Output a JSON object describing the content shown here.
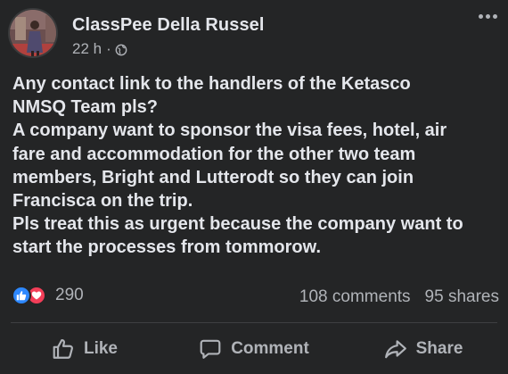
{
  "post": {
    "author": "ClassPee Della Russel",
    "time": "22 h",
    "separator": "·",
    "privacy_icon": "globe-icon",
    "lines": [
      "Any contact link to the handlers of the Ketasco",
      "NMSQ Team pls?",
      "A company want to sponsor the visa fees, hotel, air",
      "fare and accommodation for the other two team",
      "members, Bright and Lutterodt so they can join",
      "Francisca on the trip.",
      "Pls treat this as urgent because the company want to",
      "start the processes from tommorow."
    ]
  },
  "stats": {
    "reaction_icons": [
      "like-icon",
      "love-icon"
    ],
    "reactions": "290",
    "comments": "108 comments",
    "shares": "95 shares"
  },
  "actions": {
    "like": "Like",
    "comment": "Comment",
    "share": "Share"
  },
  "colors": {
    "background": "#242526",
    "text": "#e4e6eb",
    "secondary": "#b0b3b8",
    "like": "#2d88ff",
    "love": "#f33e58"
  }
}
